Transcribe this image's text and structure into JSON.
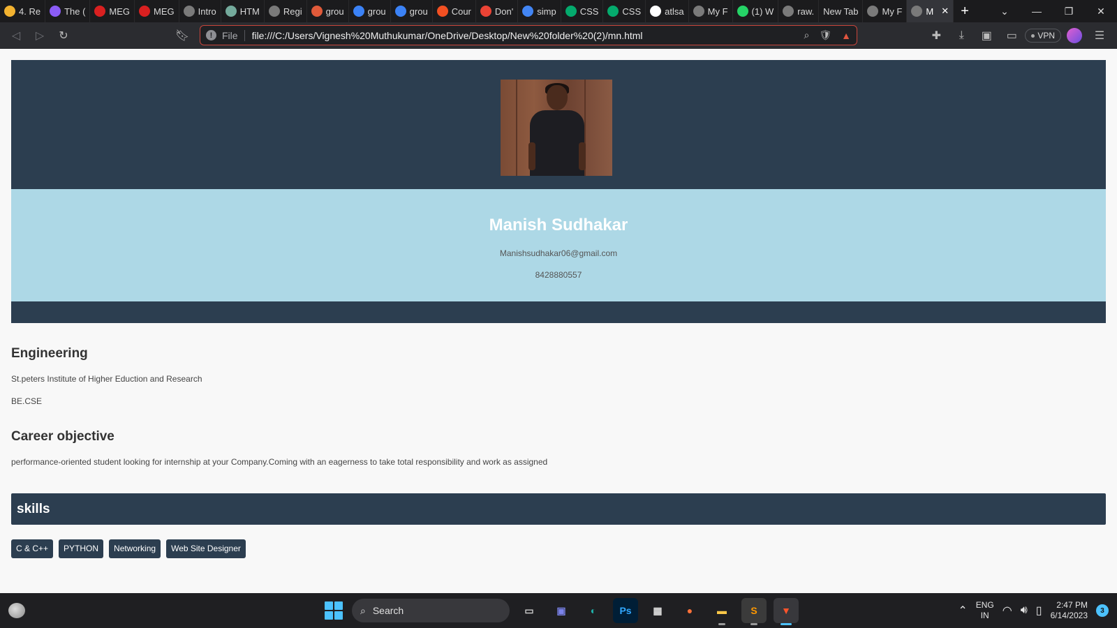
{
  "browser": {
    "tabs": [
      {
        "title": "4. Re",
        "icon": "drive-icon",
        "color": "#f2b230"
      },
      {
        "title": "The (",
        "icon": "u-icon",
        "color": "#8b5cf6"
      },
      {
        "title": "MEG",
        "icon": "m-red-icon",
        "color": "#d92020"
      },
      {
        "title": "MEG",
        "icon": "m-red-icon",
        "color": "#d92020"
      },
      {
        "title": "Intro",
        "icon": "globe-icon",
        "color": "#7a7a7a"
      },
      {
        "title": "HTM",
        "icon": "chatgpt-icon",
        "color": "#74aa9c"
      },
      {
        "title": "Regi",
        "icon": "globe-icon",
        "color": "#7a7a7a"
      },
      {
        "title": "grou",
        "icon": "brave-search-icon",
        "color": "#e05a3a"
      },
      {
        "title": "grou",
        "icon": "search-icon",
        "color": "#3b82f6"
      },
      {
        "title": "grou",
        "icon": "search-icon",
        "color": "#3b82f6"
      },
      {
        "title": "Cour",
        "icon": "microsoft-icon",
        "color": "#f25022"
      },
      {
        "title": "Don'",
        "icon": "gmail-icon",
        "color": "#ea4335"
      },
      {
        "title": "simp",
        "icon": "google-icon",
        "color": "#4285f4"
      },
      {
        "title": "CSS",
        "icon": "w3schools-icon",
        "color": "#04aa6d"
      },
      {
        "title": "CSS",
        "icon": "w3schools-icon",
        "color": "#04aa6d"
      },
      {
        "title": "atlsa",
        "icon": "github-icon",
        "color": "#ffffff"
      },
      {
        "title": "My F",
        "icon": "globe-icon",
        "color": "#7a7a7a"
      },
      {
        "title": "(1) W",
        "icon": "whatsapp-icon",
        "color": "#25d366"
      },
      {
        "title": "raw.",
        "icon": "globe-icon",
        "color": "#7a7a7a"
      },
      {
        "title": "New Tab",
        "icon": "",
        "color": ""
      },
      {
        "title": "My F",
        "icon": "globe-icon",
        "color": "#7a7a7a"
      },
      {
        "title": "M",
        "icon": "globe-icon",
        "color": "#7a7a7a",
        "active": true
      }
    ],
    "url_scheme": "File",
    "url": "file:///C:/Users/Vignesh%20Muthukumar/OneDrive/Desktop/New%20folder%20(2)/mn.html",
    "vpn_label": "VPN"
  },
  "profile": {
    "name": "Manish Sudhakar",
    "email": "Manishsudhakar06@gmail.com",
    "phone": "8428880557"
  },
  "education": {
    "title": "Engineering",
    "institution": "St.peters Institute of Higher Eduction and Research",
    "degree": "BE.CSE"
  },
  "career": {
    "title": "Career objective",
    "text": "performance-oriented student looking for internship at your Company.Coming with an eagerness to take total responsibility and work as assigned"
  },
  "skills": {
    "title": "skills",
    "items": [
      "C & C++",
      "PYTHON",
      "Networking",
      "Web Site Designer"
    ]
  },
  "taskbar": {
    "search_placeholder": "Search",
    "lang_top": "ENG",
    "lang_bottom": "IN",
    "time": "2:47 PM",
    "date": "6/14/2023",
    "notifications": "3"
  },
  "colors": {
    "header_bg": "#2c3e50",
    "bio_bg": "#add8e6",
    "chip_bg": "#2c3e50"
  }
}
